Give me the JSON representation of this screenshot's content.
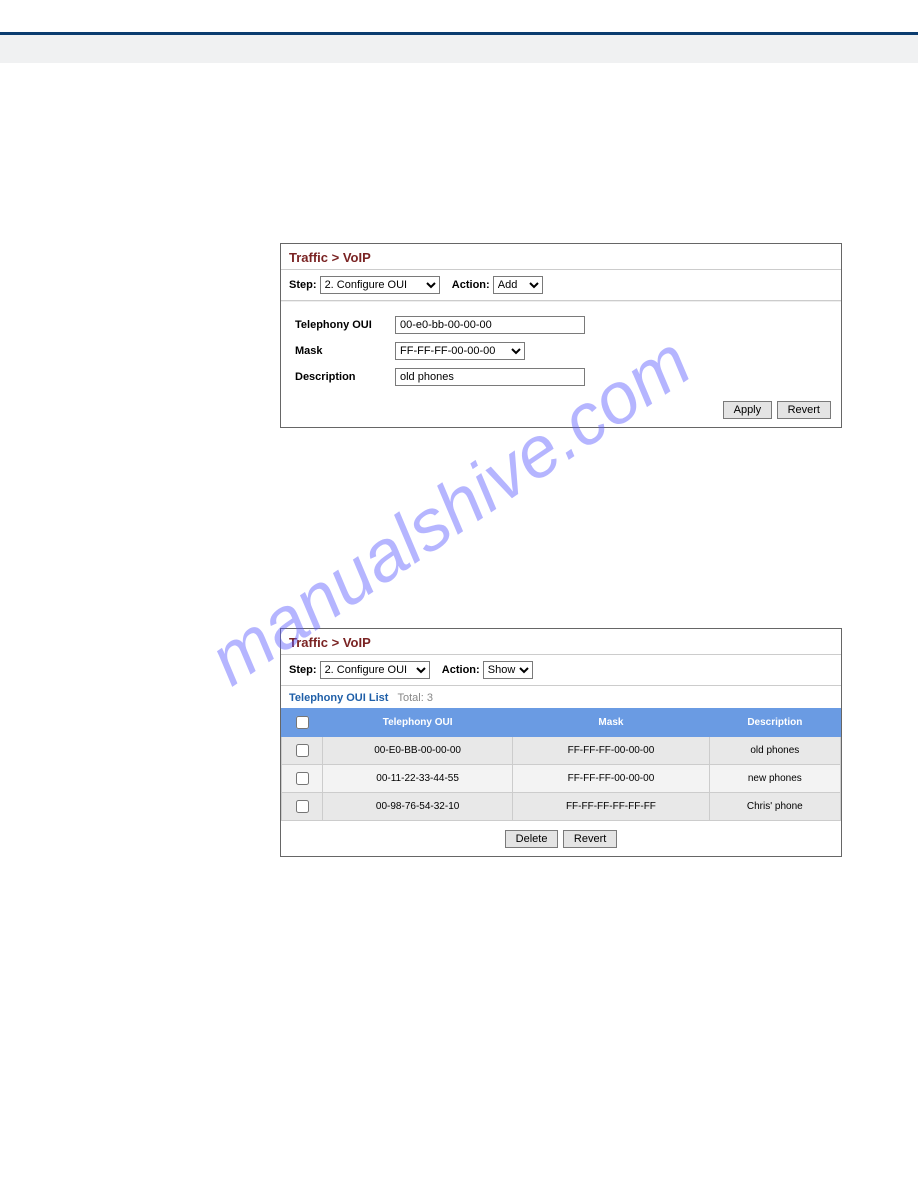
{
  "watermark": "manualshive.com",
  "panel1": {
    "title": "Traffic > VoIP",
    "step_label": "Step:",
    "step_value": "2. Configure OUI",
    "action_label": "Action:",
    "action_value": "Add",
    "fields": {
      "telephony_oui_label": "Telephony OUI",
      "telephony_oui_value": "00-e0-bb-00-00-00",
      "mask_label": "Mask",
      "mask_value": "FF-FF-FF-00-00-00",
      "description_label": "Description",
      "description_value": "old phones"
    },
    "buttons": {
      "apply": "Apply",
      "revert": "Revert"
    }
  },
  "panel2": {
    "title": "Traffic > VoIP",
    "step_label": "Step:",
    "step_value": "2. Configure OUI",
    "action_label": "Action:",
    "action_value": "Show",
    "list_title": "Telephony OUI List",
    "total_label": "Total: 3",
    "headers": {
      "oui": "Telephony OUI",
      "mask": "Mask",
      "desc": "Description"
    },
    "rows": [
      {
        "oui": "00-E0-BB-00-00-00",
        "mask": "FF-FF-FF-00-00-00",
        "desc": "old phones"
      },
      {
        "oui": "00-11-22-33-44-55",
        "mask": "FF-FF-FF-00-00-00",
        "desc": "new phones"
      },
      {
        "oui": "00-98-76-54-32-10",
        "mask": "FF-FF-FF-FF-FF-FF",
        "desc": "Chris' phone"
      }
    ],
    "buttons": {
      "delete": "Delete",
      "revert": "Revert"
    }
  }
}
